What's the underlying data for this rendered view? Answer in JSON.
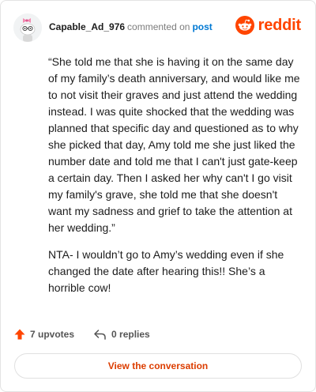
{
  "comment": {
    "username": "Capable_Ad_976",
    "action_text": "commented on",
    "post_link": "post",
    "paragraphs": [
      "“She told me that she is having it on the same day of my family’s death anniversary, and would like me to not visit their graves and just attend the wedding instead. I was quite shocked that the wedding was planned that specific day and questioned as to why she picked that day, Amy told me she just liked the number date and told me that I can't just gate-keep a certain day. Then I asked her why can't I go visit my family's grave, she told me that she doesn't want my sadness and grief to take the attention at her wedding.”",
      "NTA- I wouldn’t go to Amy’s wedding even if she changed the date after hearing this!! She’s a horrible cow!"
    ],
    "upvotes": "7 upvotes",
    "replies": "0 replies"
  },
  "brand": {
    "wordmark": "reddit",
    "accent": "#ff4500"
  },
  "buttons": {
    "view_conversation": "View the conversation"
  },
  "icons": {
    "avatar": "snoo-avatar",
    "logo": "reddit-logo-icon",
    "upvote": "upvote-arrow-icon",
    "reply": "reply-arrow-icon"
  },
  "colors": {
    "link": "#0079d3",
    "upvote": "#ff4500",
    "button_text": "#dc3d00"
  }
}
